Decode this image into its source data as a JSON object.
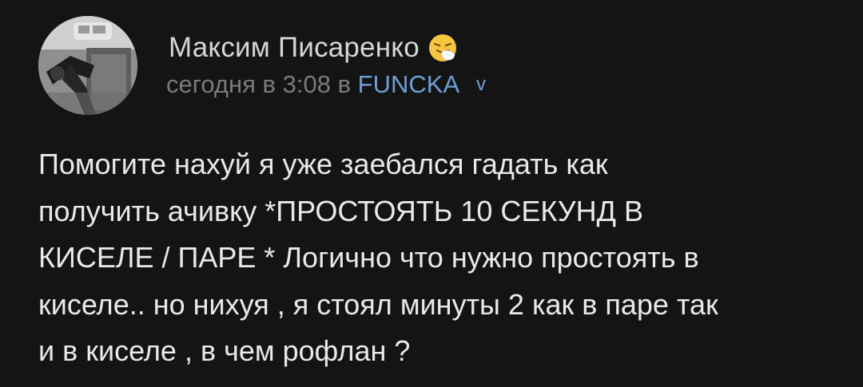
{
  "post": {
    "author": {
      "name": "Максим Писаренко",
      "avatar": "avatar-photo",
      "emoji": "sneezing-face-icon"
    },
    "meta": {
      "time": "сегодня в 3:08 в",
      "group": "FUNCKA",
      "chevron": "v"
    },
    "text": "Помогите нахуй я уже заебался гадать как\nполучить ачивку *ПРОСТОЯТЬ 10 СЕКУНД В\nКИСЕЛЕ / ПАРЕ * Логично что нужно простоять в\nкиселе.. но нихуя , я стоял минуты 2 как в паре так\nи в киселе , в чем рофлан ?"
  },
  "colors": {
    "background": "#141414",
    "text": "#e9e9e9",
    "meta": "#7a7a7a",
    "link": "#6e9fd8"
  }
}
